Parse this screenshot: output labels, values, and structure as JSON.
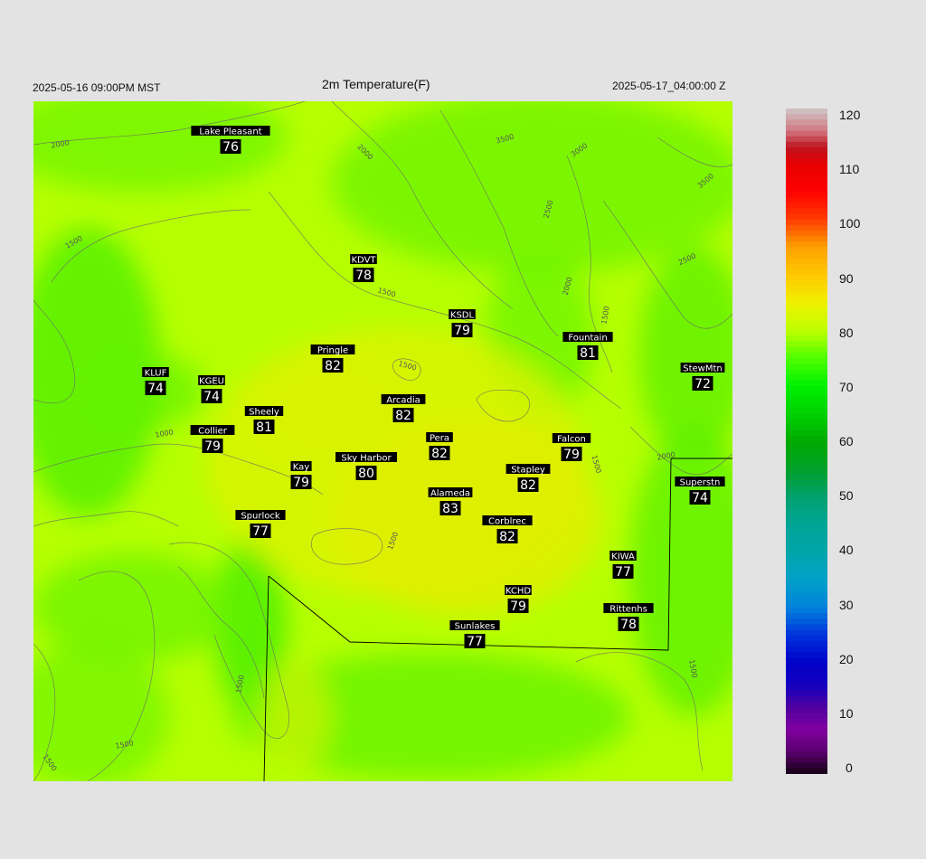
{
  "header": {
    "left": "2025-05-16 09:00PM MST",
    "title": "2m Temperature(F)",
    "right": "2025-05-17_04:00:00 Z"
  },
  "stations": [
    {
      "name": "Lake Pleasant",
      "value": "76"
    },
    {
      "name": "KDVT",
      "value": "78"
    },
    {
      "name": "KSDL",
      "value": "79"
    },
    {
      "name": "Fountain",
      "value": "81"
    },
    {
      "name": "Pringle",
      "value": "82"
    },
    {
      "name": "KLUF",
      "value": "74"
    },
    {
      "name": "KGEU",
      "value": "74"
    },
    {
      "name": "StewMtn",
      "value": "72"
    },
    {
      "name": "Arcadia",
      "value": "82"
    },
    {
      "name": "Sheely",
      "value": "81"
    },
    {
      "name": "Collier",
      "value": "79"
    },
    {
      "name": "Pera",
      "value": "82"
    },
    {
      "name": "Falcon",
      "value": "79"
    },
    {
      "name": "Sky Harbor",
      "value": "80"
    },
    {
      "name": "Kay",
      "value": "79"
    },
    {
      "name": "Stapley",
      "value": "82"
    },
    {
      "name": "Superstn",
      "value": "74"
    },
    {
      "name": "Alameda",
      "value": "83"
    },
    {
      "name": "Spurlock",
      "value": "77"
    },
    {
      "name": "Corblrec",
      "value": "82"
    },
    {
      "name": "KIWA",
      "value": "77"
    },
    {
      "name": "KCHD",
      "value": "79"
    },
    {
      "name": "Rittenhs",
      "value": "78"
    },
    {
      "name": "Sunlakes",
      "value": "77"
    }
  ],
  "contour_labels": [
    "2000",
    "2000",
    "3500",
    "3000",
    "3500",
    "2500",
    "2500",
    "2000",
    "1500",
    "1500",
    "1500",
    "1500",
    "1000",
    "1500",
    "2000",
    "1500",
    "1500",
    "1500",
    "1500",
    "1500"
  ],
  "colorbar": {
    "ticks": [
      "120",
      "110",
      "100",
      "90",
      "80",
      "70",
      "60",
      "50",
      "40",
      "30",
      "20",
      "10",
      "0"
    ],
    "min": 0,
    "max": 120
  },
  "colors": {
    "background": "#e3e3e3",
    "field_base": "#b4ff00",
    "field_warm": "#dcf000",
    "field_cool": "#5cf000"
  }
}
